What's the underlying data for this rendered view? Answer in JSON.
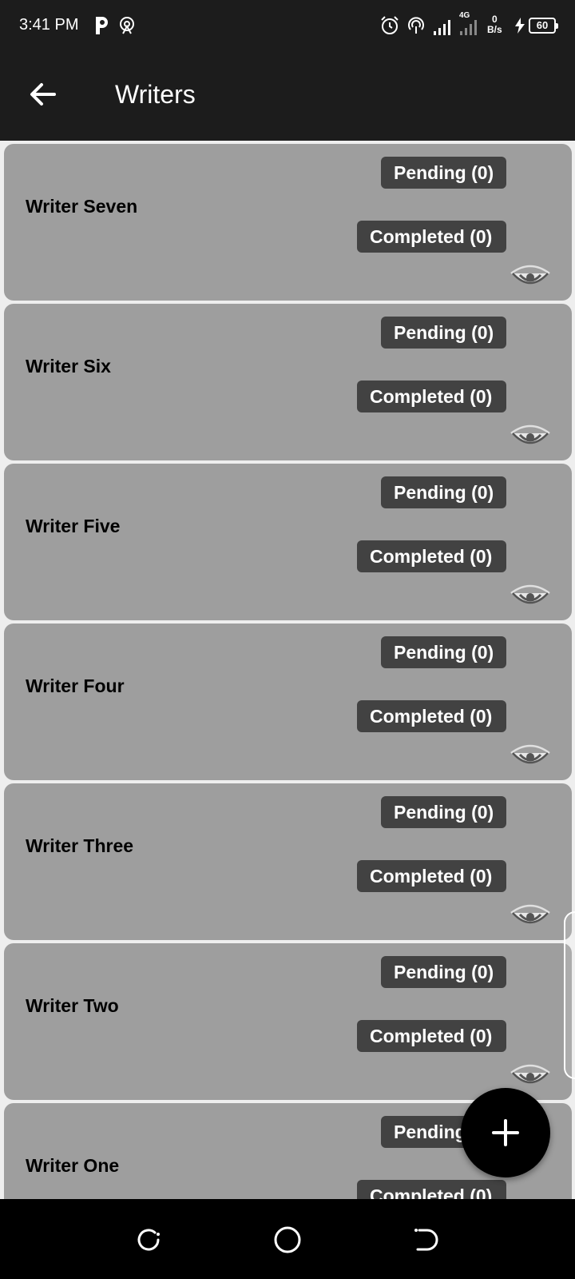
{
  "status_bar": {
    "time": "3:41 PM",
    "network_tag": "4G",
    "speed_value": "0",
    "speed_unit": "B/s",
    "battery": "60",
    "icons": [
      "p-app-icon",
      "hotspot-icon",
      "alarm-icon",
      "hotspot-icon",
      "signal-icon",
      "signal-icon",
      "charging-icon",
      "battery-icon"
    ]
  },
  "app_bar": {
    "title": "Writers",
    "back_icon": "arrow-left-icon"
  },
  "writers": [
    {
      "name": "Writer Seven",
      "pending": "Pending (0)",
      "completed": "Completed (0)"
    },
    {
      "name": "Writer Six",
      "pending": "Pending (0)",
      "completed": "Completed (0)"
    },
    {
      "name": "Writer Five",
      "pending": "Pending (0)",
      "completed": "Completed (0)"
    },
    {
      "name": "Writer Four",
      "pending": "Pending (0)",
      "completed": "Completed (0)"
    },
    {
      "name": "Writer Three",
      "pending": "Pending (0)",
      "completed": "Completed (0)"
    },
    {
      "name": "Writer Two",
      "pending": "Pending (0)",
      "completed": "Completed (0)"
    },
    {
      "name": "Writer One",
      "pending": "Pending (0)",
      "completed": "Completed (0)"
    }
  ],
  "fab": {
    "icon": "plus-icon"
  },
  "nav_bar": {
    "icons": [
      "recents-icon",
      "home-icon",
      "back-icon"
    ]
  },
  "colors": {
    "bar_background": "#1c1c1c",
    "card_background": "#9e9e9e",
    "badge_background": "#424242",
    "fab_background": "#000000"
  }
}
